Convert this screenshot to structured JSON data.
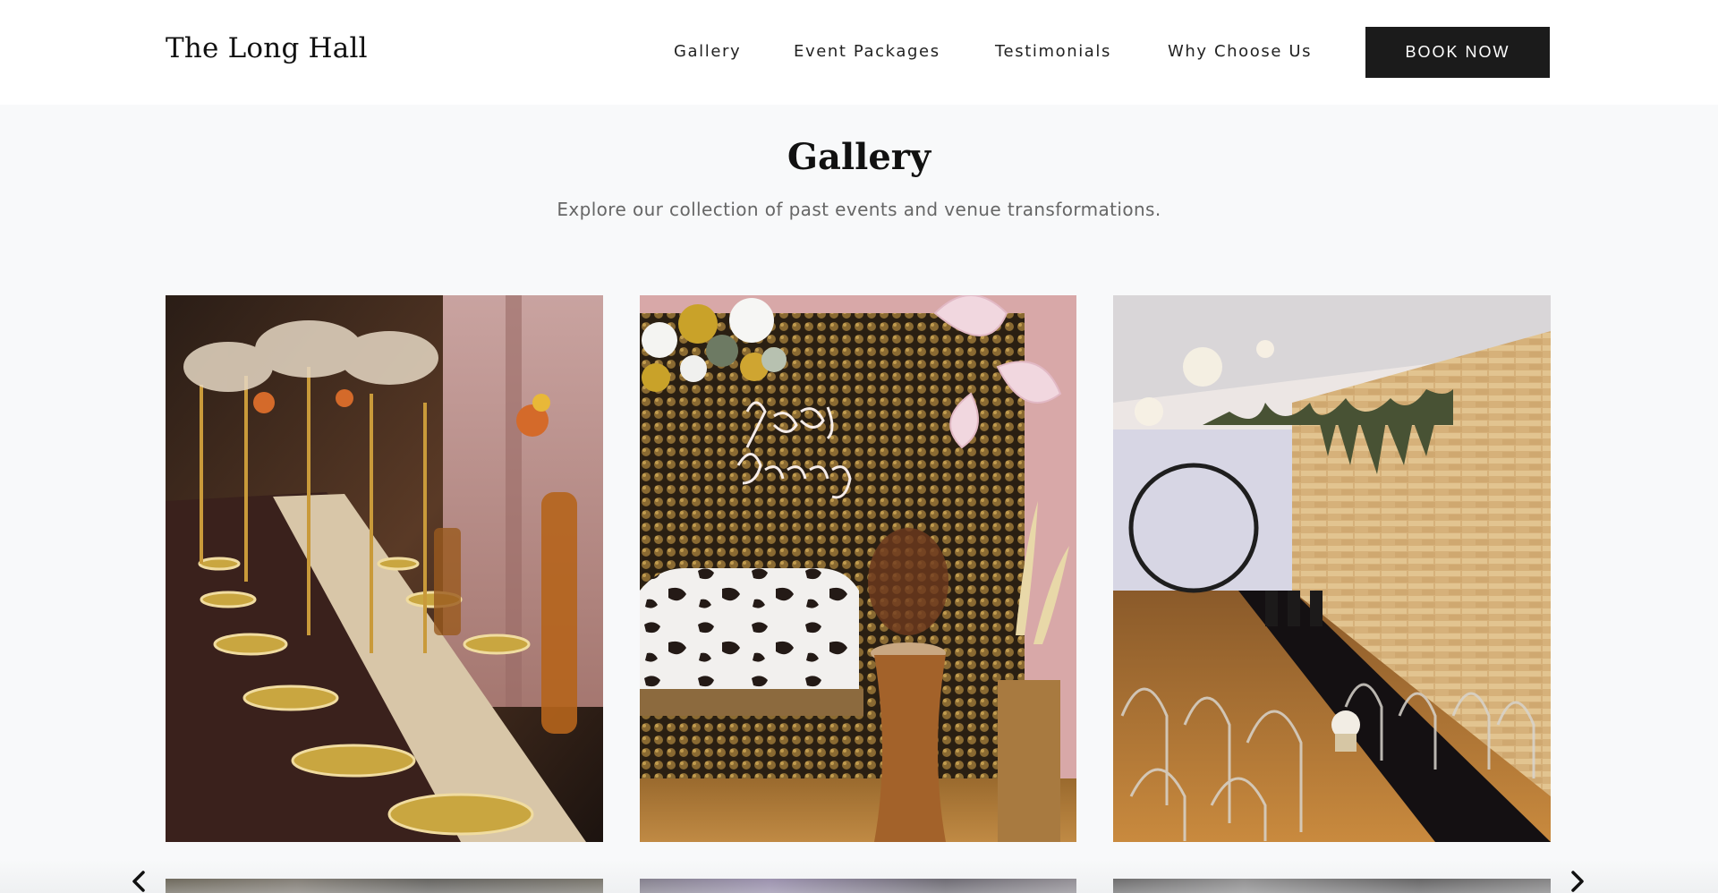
{
  "header": {
    "logo": "The Long Hall",
    "nav": [
      "Gallery",
      "Event Packages",
      "Testimonials",
      "Why Choose Us"
    ],
    "cta": "BOOK NOW"
  },
  "gallery": {
    "title": "Gallery",
    "subtitle": "Explore our collection of past events and venue transformations."
  },
  "images": [
    {
      "icon": "banquet-table-photo"
    },
    {
      "icon": "birthday-backdrop-photo"
    },
    {
      "icon": "ceremony-hall-photo"
    }
  ],
  "controls": {
    "prev_icon": "chevron-left-icon",
    "next_icon": "chevron-right-icon"
  },
  "colors": {
    "background": "#f8f9fa",
    "header": "#ffffff",
    "cta": "#1b1b1b"
  }
}
